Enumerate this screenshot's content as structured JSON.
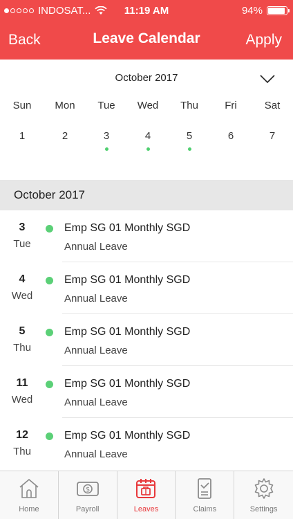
{
  "status_bar": {
    "carrier": "INDOSAT...",
    "time": "11:19 AM",
    "battery": "94%",
    "battery_level": 0.94
  },
  "nav": {
    "back_label": "Back",
    "title": "Leave Calendar",
    "apply_label": "Apply"
  },
  "calendar": {
    "month_label": "October 2017",
    "weekdays": [
      "Sun",
      "Mon",
      "Tue",
      "Wed",
      "Thu",
      "Fri",
      "Sat"
    ],
    "days": [
      "1",
      "2",
      "3",
      "4",
      "5",
      "6",
      "7"
    ],
    "marked_days": [
      "3",
      "4",
      "5"
    ],
    "marker_color": "#4fcf6f"
  },
  "section": {
    "header": "October 2017"
  },
  "leaves": [
    {
      "day": "3",
      "weekday": "Tue",
      "employee": "Emp SG 01 Monthly SGD",
      "leave_type": "Annual Leave"
    },
    {
      "day": "4",
      "weekday": "Wed",
      "employee": "Emp SG 01 Monthly SGD",
      "leave_type": "Annual Leave"
    },
    {
      "day": "5",
      "weekday": "Thu",
      "employee": "Emp SG 01 Monthly SGD",
      "leave_type": "Annual Leave"
    },
    {
      "day": "11",
      "weekday": "Wed",
      "employee": "Emp SG 01 Monthly SGD",
      "leave_type": "Annual Leave"
    },
    {
      "day": "12",
      "weekday": "Thu",
      "employee": "Emp SG 01 Monthly SGD",
      "leave_type": "Annual Leave"
    }
  ],
  "tabs": [
    {
      "label": "Home",
      "icon": "home-icon",
      "active": false
    },
    {
      "label": "Payroll",
      "icon": "payroll-icon",
      "active": false
    },
    {
      "label": "Leaves",
      "icon": "leaves-calendar-icon",
      "active": true
    },
    {
      "label": "Claims",
      "icon": "claims-icon",
      "active": false
    },
    {
      "label": "Settings",
      "icon": "gear-icon",
      "active": false
    }
  ],
  "colors": {
    "brand": "#f04a4a",
    "active_tab": "#e8383b",
    "leave_dot": "#5bd077"
  }
}
